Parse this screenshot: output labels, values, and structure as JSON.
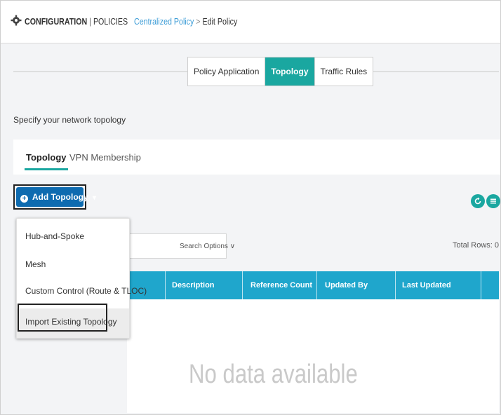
{
  "header": {
    "section": "CONFIGURATION",
    "separator": "|",
    "subsection": "POLICIES",
    "breadcrumb_link": "Centralized Policy",
    "breadcrumb_arrow": ">",
    "current_page": "Edit Policy"
  },
  "policy_tabs": [
    {
      "label": "Policy Application",
      "active": false
    },
    {
      "label": "Topology",
      "active": true
    },
    {
      "label": "Traffic Rules",
      "active": false
    }
  ],
  "instruction": "Specify your network topology",
  "sub_tabs": [
    {
      "label": "Topology",
      "active": true
    },
    {
      "label": "VPN Membership",
      "active": false
    }
  ],
  "add_button": {
    "label": "Add Topology",
    "caret": "▾"
  },
  "dropdown": {
    "items": [
      {
        "label": "Hub-and-Spoke"
      },
      {
        "label": "Mesh"
      },
      {
        "label": "Custom Control (Route & TLOC)"
      },
      {
        "label": "Import Existing Topology",
        "highlighted": true
      }
    ]
  },
  "search": {
    "options_label": "Search Options ∨"
  },
  "total_rows": "Total Rows: 0",
  "table": {
    "columns": [
      "Description",
      "Reference Count",
      "Updated By",
      "Last Updated"
    ]
  },
  "empty_message": "No data available",
  "icons": {
    "refresh": "refresh-icon",
    "menu": "menu-icon",
    "gear": "gear-icon"
  },
  "colors": {
    "accent": "#1aa7a0",
    "button": "#0e6bb0",
    "table_header": "#1fa6cc",
    "link": "#3a9bd6"
  }
}
